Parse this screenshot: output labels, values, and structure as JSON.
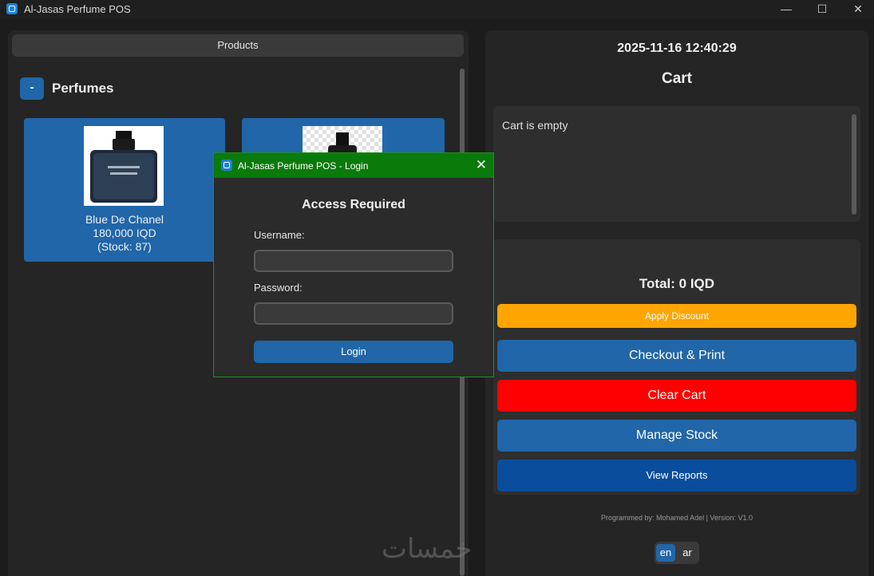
{
  "window": {
    "title": "Al-Jasas Perfume POS",
    "controls": {
      "minimize": "—",
      "maximize": "☐",
      "close": "✕"
    }
  },
  "products_panel": {
    "header": "Products",
    "collapse_label": "-",
    "category": "Perfumes",
    "items": [
      {
        "name": "Blue De Chanel",
        "price": "180,000 IQD",
        "stock": "(Stock: 87)",
        "icon": "perfume-bottle-icon"
      },
      {
        "name": "",
        "price": "",
        "stock": "",
        "icon": "perfume-bottle-icon"
      }
    ]
  },
  "cart_panel": {
    "datetime": "2025-11-16 12:40:29",
    "title": "Cart",
    "empty_text": "Cart is empty",
    "total": "Total: 0 IQD",
    "buttons": {
      "apply_discount": "Apply Discount",
      "checkout": "Checkout & Print",
      "clear_cart": "Clear Cart",
      "manage_stock": "Manage Stock",
      "view_reports": "View Reports"
    },
    "footer": "Programmed by: Mohamed Adel | Version: V1.0",
    "languages": [
      "en",
      "ar"
    ],
    "active_language": "en"
  },
  "login_dialog": {
    "title": "Al-Jasas Perfume POS - Login",
    "close": "✕",
    "heading": "Access Required",
    "username_label": "Username:",
    "username_value": "",
    "password_label": "Password:",
    "password_value": "",
    "login_button": "Login"
  },
  "watermark": "خمسات",
  "colors": {
    "accent_blue": "#2066a8",
    "discount_orange": "#ffa500",
    "clear_red": "#ff0000",
    "reports_dark_blue": "#0a4d9c",
    "dialog_green": "#0a7a0a"
  }
}
